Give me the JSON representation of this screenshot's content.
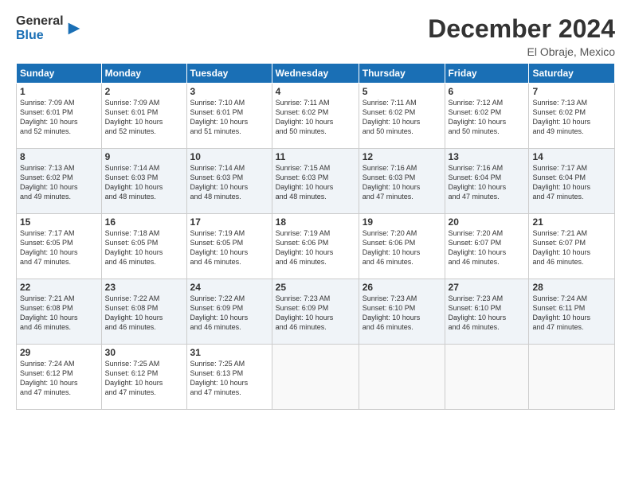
{
  "logo": {
    "general": "General",
    "blue": "Blue",
    "arrow_color": "#1a6fb5"
  },
  "header": {
    "month_year": "December 2024",
    "location": "El Obraje, Mexico"
  },
  "weekdays": [
    "Sunday",
    "Monday",
    "Tuesday",
    "Wednesday",
    "Thursday",
    "Friday",
    "Saturday"
  ],
  "weeks": [
    [
      {
        "day": "1",
        "sunrise": "7:09 AM",
        "sunset": "6:01 PM",
        "daylight": "10 hours and 52 minutes."
      },
      {
        "day": "2",
        "sunrise": "7:09 AM",
        "sunset": "6:01 PM",
        "daylight": "10 hours and 52 minutes."
      },
      {
        "day": "3",
        "sunrise": "7:10 AM",
        "sunset": "6:01 PM",
        "daylight": "10 hours and 51 minutes."
      },
      {
        "day": "4",
        "sunrise": "7:11 AM",
        "sunset": "6:02 PM",
        "daylight": "10 hours and 50 minutes."
      },
      {
        "day": "5",
        "sunrise": "7:11 AM",
        "sunset": "6:02 PM",
        "daylight": "10 hours and 50 minutes."
      },
      {
        "day": "6",
        "sunrise": "7:12 AM",
        "sunset": "6:02 PM",
        "daylight": "10 hours and 50 minutes."
      },
      {
        "day": "7",
        "sunrise": "7:13 AM",
        "sunset": "6:02 PM",
        "daylight": "10 hours and 49 minutes."
      }
    ],
    [
      {
        "day": "8",
        "sunrise": "7:13 AM",
        "sunset": "6:02 PM",
        "daylight": "10 hours and 49 minutes."
      },
      {
        "day": "9",
        "sunrise": "7:14 AM",
        "sunset": "6:03 PM",
        "daylight": "10 hours and 48 minutes."
      },
      {
        "day": "10",
        "sunrise": "7:14 AM",
        "sunset": "6:03 PM",
        "daylight": "10 hours and 48 minutes."
      },
      {
        "day": "11",
        "sunrise": "7:15 AM",
        "sunset": "6:03 PM",
        "daylight": "10 hours and 48 minutes."
      },
      {
        "day": "12",
        "sunrise": "7:16 AM",
        "sunset": "6:03 PM",
        "daylight": "10 hours and 47 minutes."
      },
      {
        "day": "13",
        "sunrise": "7:16 AM",
        "sunset": "6:04 PM",
        "daylight": "10 hours and 47 minutes."
      },
      {
        "day": "14",
        "sunrise": "7:17 AM",
        "sunset": "6:04 PM",
        "daylight": "10 hours and 47 minutes."
      }
    ],
    [
      {
        "day": "15",
        "sunrise": "7:17 AM",
        "sunset": "6:05 PM",
        "daylight": "10 hours and 47 minutes."
      },
      {
        "day": "16",
        "sunrise": "7:18 AM",
        "sunset": "6:05 PM",
        "daylight": "10 hours and 46 minutes."
      },
      {
        "day": "17",
        "sunrise": "7:19 AM",
        "sunset": "6:05 PM",
        "daylight": "10 hours and 46 minutes."
      },
      {
        "day": "18",
        "sunrise": "7:19 AM",
        "sunset": "6:06 PM",
        "daylight": "10 hours and 46 minutes."
      },
      {
        "day": "19",
        "sunrise": "7:20 AM",
        "sunset": "6:06 PM",
        "daylight": "10 hours and 46 minutes."
      },
      {
        "day": "20",
        "sunrise": "7:20 AM",
        "sunset": "6:07 PM",
        "daylight": "10 hours and 46 minutes."
      },
      {
        "day": "21",
        "sunrise": "7:21 AM",
        "sunset": "6:07 PM",
        "daylight": "10 hours and 46 minutes."
      }
    ],
    [
      {
        "day": "22",
        "sunrise": "7:21 AM",
        "sunset": "6:08 PM",
        "daylight": "10 hours and 46 minutes."
      },
      {
        "day": "23",
        "sunrise": "7:22 AM",
        "sunset": "6:08 PM",
        "daylight": "10 hours and 46 minutes."
      },
      {
        "day": "24",
        "sunrise": "7:22 AM",
        "sunset": "6:09 PM",
        "daylight": "10 hours and 46 minutes."
      },
      {
        "day": "25",
        "sunrise": "7:23 AM",
        "sunset": "6:09 PM",
        "daylight": "10 hours and 46 minutes."
      },
      {
        "day": "26",
        "sunrise": "7:23 AM",
        "sunset": "6:10 PM",
        "daylight": "10 hours and 46 minutes."
      },
      {
        "day": "27",
        "sunrise": "7:23 AM",
        "sunset": "6:10 PM",
        "daylight": "10 hours and 46 minutes."
      },
      {
        "day": "28",
        "sunrise": "7:24 AM",
        "sunset": "6:11 PM",
        "daylight": "10 hours and 47 minutes."
      }
    ],
    [
      {
        "day": "29",
        "sunrise": "7:24 AM",
        "sunset": "6:12 PM",
        "daylight": "10 hours and 47 minutes."
      },
      {
        "day": "30",
        "sunrise": "7:25 AM",
        "sunset": "6:12 PM",
        "daylight": "10 hours and 47 minutes."
      },
      {
        "day": "31",
        "sunrise": "7:25 AM",
        "sunset": "6:13 PM",
        "daylight": "10 hours and 47 minutes."
      },
      null,
      null,
      null,
      null
    ]
  ]
}
